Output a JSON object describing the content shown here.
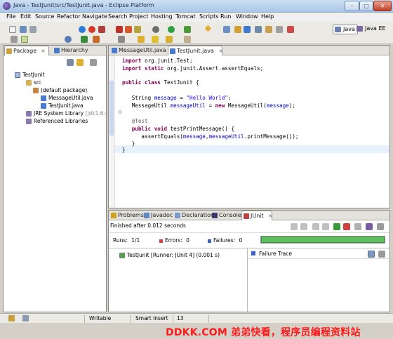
{
  "window": {
    "title": "Java - TestJunit/src/TestJunit.java - Eclipse Platform",
    "minimize": "–",
    "maximize": "□",
    "close": "✕"
  },
  "menu": [
    "File",
    "Edit",
    "Source",
    "Refactor",
    "Navigate",
    "Search",
    "Project",
    "Hosting",
    "Tomcat",
    "Scripts",
    "Run",
    "Window",
    "Help"
  ],
  "perspectives": {
    "java": "Java",
    "javaee": "Java EE"
  },
  "package_explorer": {
    "tabs": [
      "Package",
      "Hierarchy"
    ],
    "tree": [
      {
        "label": "TestJunit",
        "level": 0,
        "icon": "project-icon"
      },
      {
        "label": "src",
        "level": 1,
        "icon": "source-folder-icon"
      },
      {
        "label": "(default package)",
        "level": 2,
        "icon": "package-icon"
      },
      {
        "label": "MessageUtil.java",
        "level": 3,
        "icon": "java-file-icon"
      },
      {
        "label": "TestJunit.java",
        "level": 3,
        "icon": "java-file-icon"
      },
      {
        "label": "JRE System Library",
        "suffix": "[jdk1.6.0_21]",
        "level": 1,
        "icon": "library-icon"
      },
      {
        "label": "Referenced Libraries",
        "level": 1,
        "icon": "library-icon"
      }
    ]
  },
  "editor": {
    "tabs": [
      "MessageUtil.java",
      "TestJunit.java"
    ],
    "lines": [
      "import org.junit.Test;",
      "import static org.junit.Assert.assertEquals;",
      "",
      "public class TestJunit {",
      "",
      "   String message = \"Hello World\";",
      "   MessageUtil messageUtil = new MessageUtil(message);",
      "",
      "   @Test",
      "   public void testPrintMessage() {",
      "      assertEquals(message,messageUtil.printMessage());",
      "   }",
      "}"
    ]
  },
  "bottom_panel": {
    "tabs": [
      "Problems",
      "Javadoc",
      "Declaration",
      "Console",
      "JUnit"
    ],
    "status": "Finished after 0.012 seconds",
    "runs_label": "Runs:",
    "runs_value": "1/1",
    "errors_label": "Errors:",
    "errors_value": "0",
    "failures_label": "Failures:",
    "failures_value": "0",
    "progress": 1.0,
    "test_result": "TestJunit [Runner: JUnit 4] (0.001 s)",
    "failure_trace_label": "Failure Trace"
  },
  "statusbar": {
    "writable": "Writable",
    "insert_mode": "Smart Insert",
    "line": "13"
  },
  "watermark": "DDKK.COM 弟弟快看，程序员编程资料站",
  "colors": {
    "keyword": "#7f0055",
    "string": "#2a00ff",
    "field": "#0000c0",
    "junit_green": "#5fbf5f",
    "watermark": "#ff1a1a"
  }
}
